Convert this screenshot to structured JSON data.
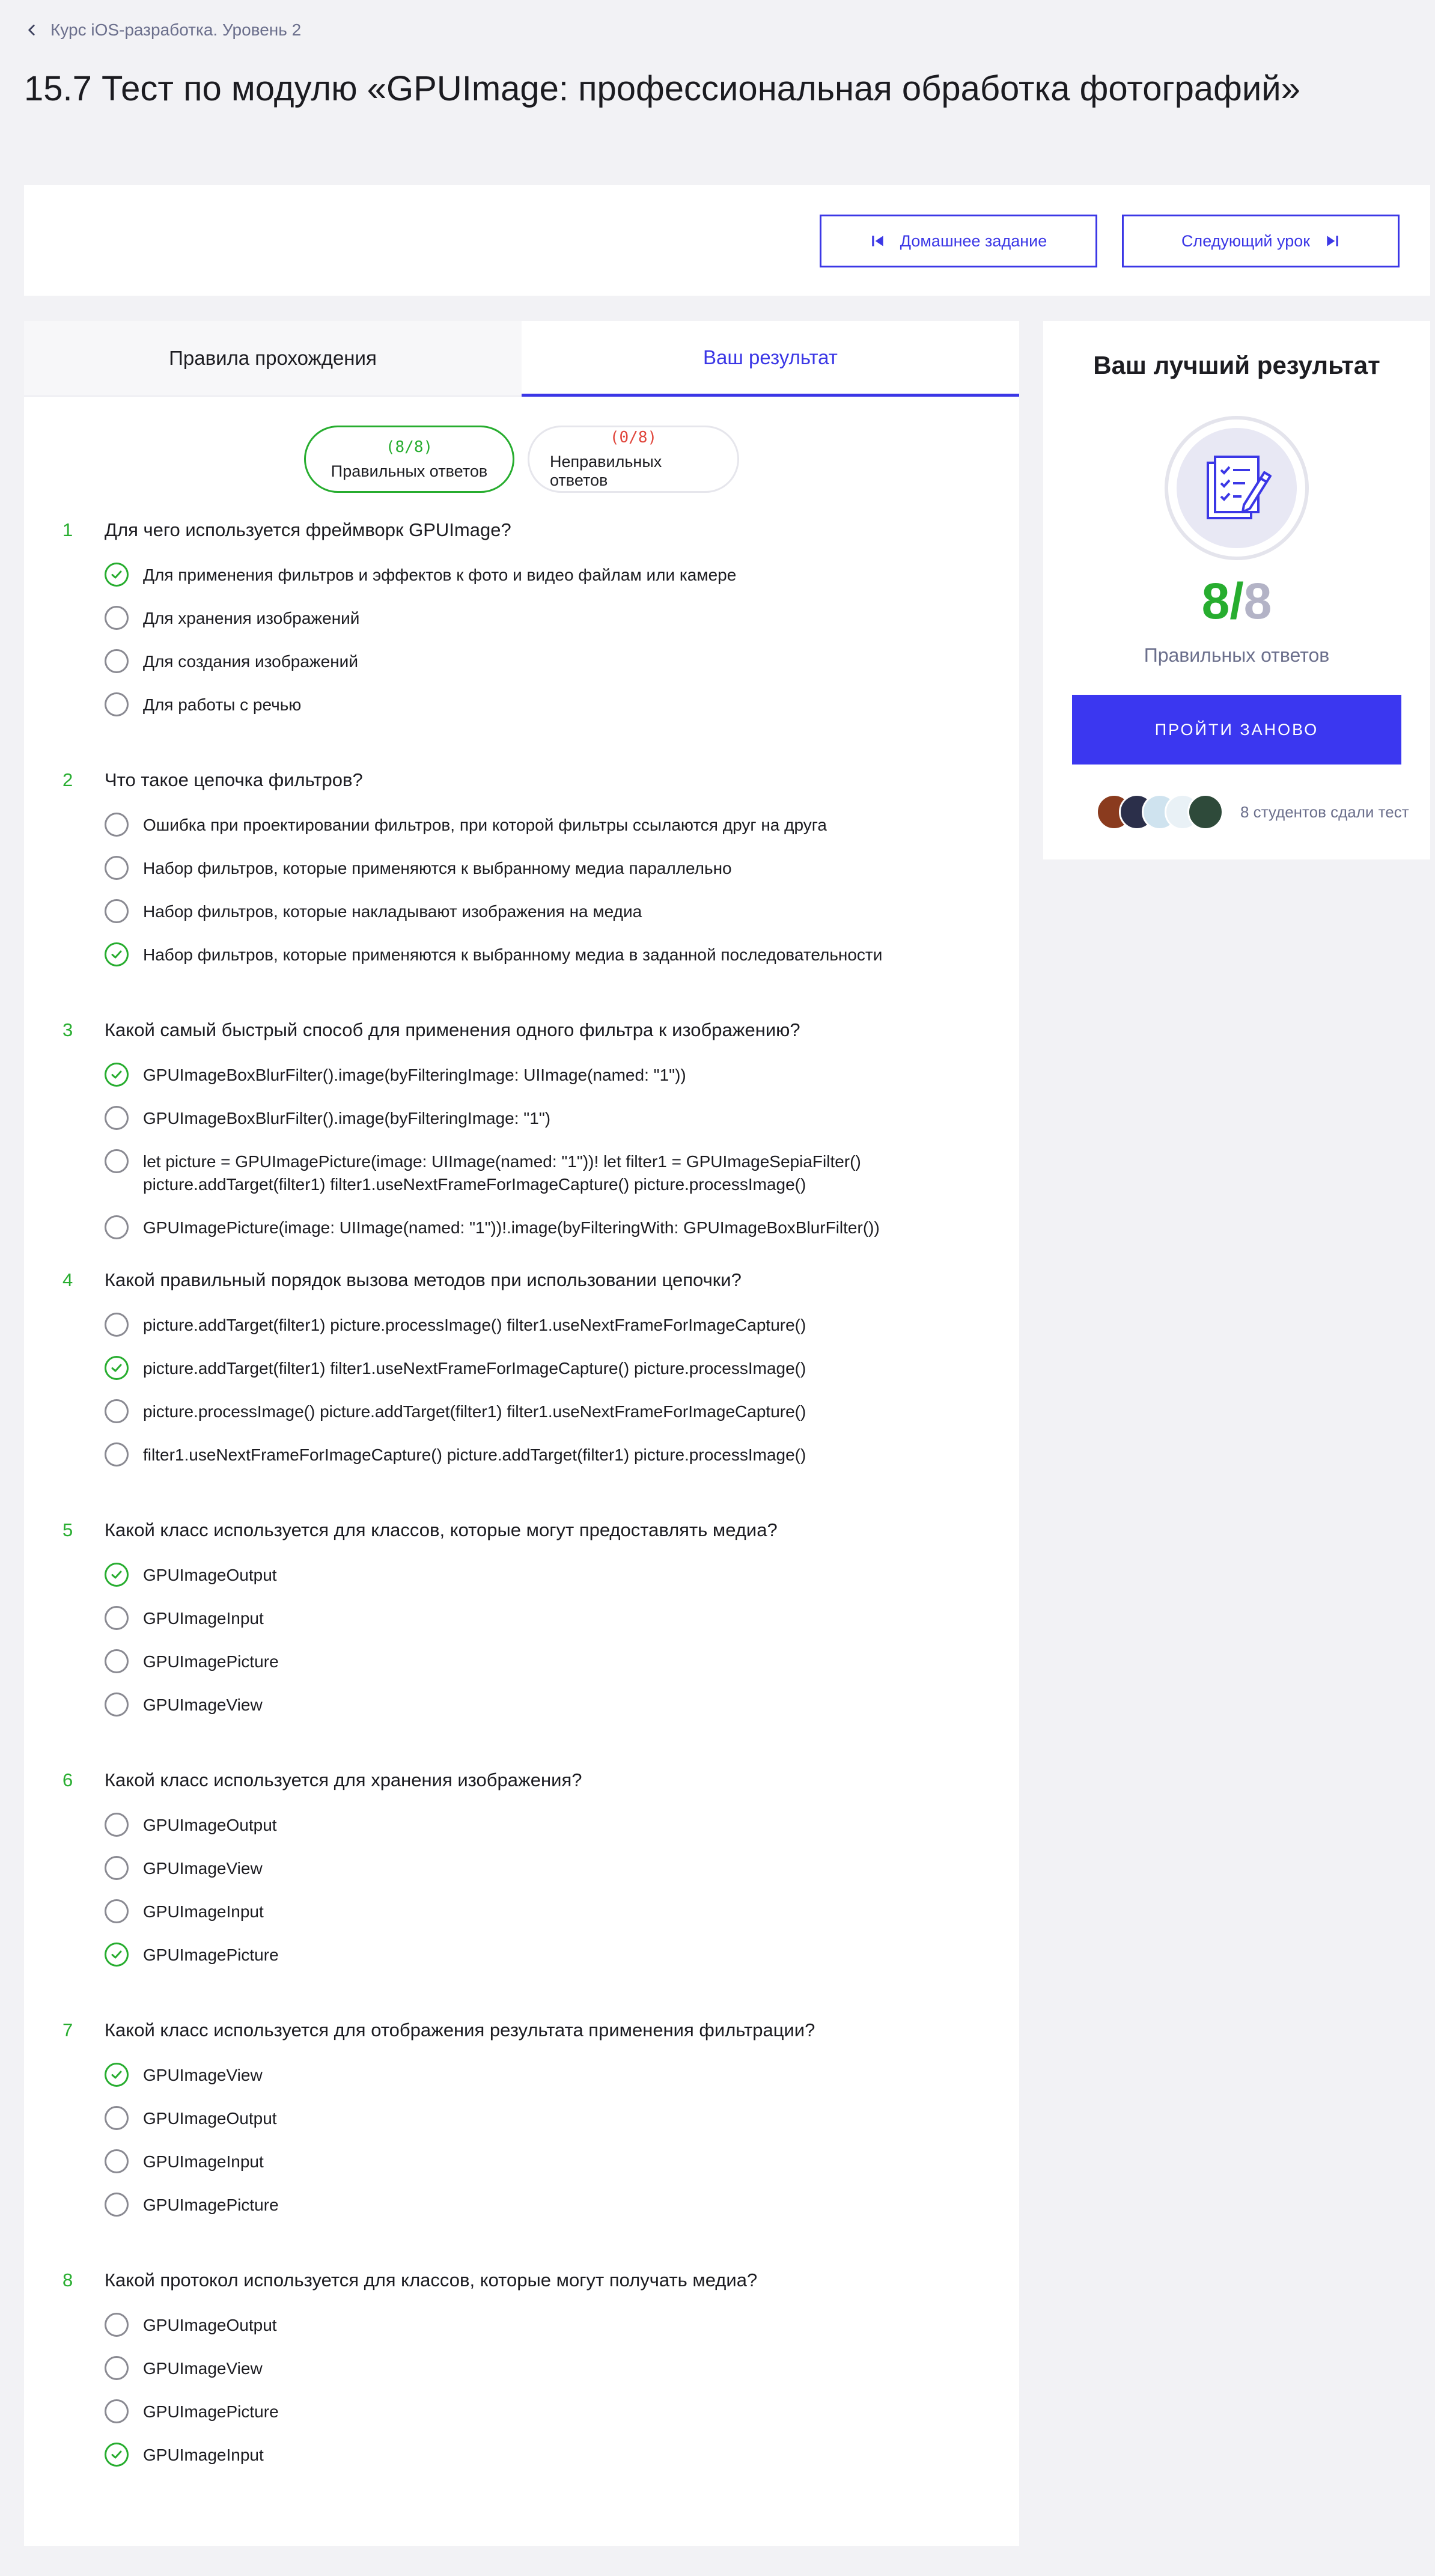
{
  "breadcrumb": {
    "label": "Курс iOS-разработка. Уровень 2"
  },
  "page_title": "15.7 Тест по модулю «GPUImage: профессиональная обработка фотографий»",
  "nav": {
    "homework_label": "Домашнее задание",
    "next_label": "Следующий урок"
  },
  "tabs": [
    {
      "label": "Правила прохождения",
      "active": false
    },
    {
      "label": "Ваш результат",
      "active": true
    }
  ],
  "summary": {
    "correct_count": "(8/8)",
    "correct_label": "Правильных ответов",
    "wrong_count": "(0/8)",
    "wrong_label": "Неправильных ответов"
  },
  "questions": [
    {
      "number": "1",
      "text": "Для чего используется фреймворк GPUImage?",
      "answers": [
        {
          "text": "Для применения фильтров и эффектов к фото и видео файлам или камере",
          "checked": true
        },
        {
          "text": "Для хранения изображений",
          "checked": false
        },
        {
          "text": "Для создания изображений",
          "checked": false
        },
        {
          "text": "Для работы с речью",
          "checked": false
        }
      ]
    },
    {
      "number": "2",
      "text": "Что такое цепочка фильтров?",
      "answers": [
        {
          "text": "Ошибка при проектировании фильтров, при которой фильтры ссылаются друг на друга",
          "checked": false
        },
        {
          "text": "Набор фильтров, которые применяются к выбранному медиа параллельно",
          "checked": false
        },
        {
          "text": "Набор фильтров, которые накладывают изображения на медиа",
          "checked": false
        },
        {
          "text": "Набор фильтров, которые применяются к выбранному медиа в заданной последовательности",
          "checked": true
        }
      ]
    },
    {
      "number": "3",
      "text": "Какой самый быстрый способ для применения одного фильтра к изображению?",
      "answers": [
        {
          "text": "GPUImageBoxBlurFilter().image(byFilteringImage: UIImage(named: \"1\"))",
          "checked": true
        },
        {
          "text": "GPUImageBoxBlurFilter().image(byFilteringImage: \"1\")",
          "checked": false
        },
        {
          "text": "let picture = GPUImagePicture(image: UIImage(named: \"1\"))! let filter1 = GPUImageSepiaFilter() picture.addTarget(filter1) filter1.useNextFrameForImageCapture() picture.processImage()",
          "checked": false
        },
        {
          "text": "GPUImagePicture(image: UIImage(named: \"1\"))!.image(byFilteringWith: GPUImageBoxBlurFilter())",
          "checked": false
        }
      ]
    },
    {
      "number": "4",
      "text": "Какой правильный порядок вызова методов при использовании цепочки?",
      "answers": [
        {
          "text": "picture.addTarget(filter1) picture.processImage() filter1.useNextFrameForImageCapture()",
          "checked": false
        },
        {
          "text": "picture.addTarget(filter1) filter1.useNextFrameForImageCapture() picture.processImage()",
          "checked": true
        },
        {
          "text": "picture.processImage() picture.addTarget(filter1) filter1.useNextFrameForImageCapture()",
          "checked": false
        },
        {
          "text": "filter1.useNextFrameForImageCapture() picture.addTarget(filter1) picture.processImage()",
          "checked": false
        }
      ]
    },
    {
      "number": "5",
      "text": "Какой класс используется для классов, которые могут предоставлять медиа?",
      "answers": [
        {
          "text": "GPUImageOutput",
          "checked": true
        },
        {
          "text": "GPUImageInput",
          "checked": false
        },
        {
          "text": "GPUImagePicture",
          "checked": false
        },
        {
          "text": "GPUImageView",
          "checked": false
        }
      ]
    },
    {
      "number": "6",
      "text": "Какой класс используется для хранения изображения?",
      "answers": [
        {
          "text": "GPUImageOutput",
          "checked": false
        },
        {
          "text": "GPUImageView",
          "checked": false
        },
        {
          "text": "GPUImageInput",
          "checked": false
        },
        {
          "text": "GPUImagePicture",
          "checked": true
        }
      ]
    },
    {
      "number": "7",
      "text": "Какой класс используется для отображения результата применения фильтрации?",
      "answers": [
        {
          "text": "GPUImageView",
          "checked": true
        },
        {
          "text": "GPUImageOutput",
          "checked": false
        },
        {
          "text": "GPUImageInput",
          "checked": false
        },
        {
          "text": "GPUImagePicture",
          "checked": false
        }
      ]
    },
    {
      "number": "8",
      "text": "Какой протокол используется для классов, которые могут получать медиа?",
      "answers": [
        {
          "text": "GPUImageOutput",
          "checked": false
        },
        {
          "text": "GPUImageView",
          "checked": false
        },
        {
          "text": "GPUImagePicture",
          "checked": false
        },
        {
          "text": "GPUImageInput",
          "checked": true
        }
      ]
    }
  ],
  "best_result": {
    "title": "Ваш лучший результат",
    "score_got": "8",
    "score_slash": "/",
    "score_total": "8",
    "score_label": "Правильных ответов",
    "retry_label": "ПРОЙТИ ЗАНОВО",
    "students_text": "8 студентов сдали тест",
    "avatar_colors": [
      "#8a3b1e",
      "#2b2f4a",
      "#cfe3ef",
      "#e9f1f6",
      "#2e4a3a"
    ]
  },
  "colors": {
    "accent": "#3b37e6",
    "correct": "#27ad2f",
    "wrong": "#e0453b"
  }
}
